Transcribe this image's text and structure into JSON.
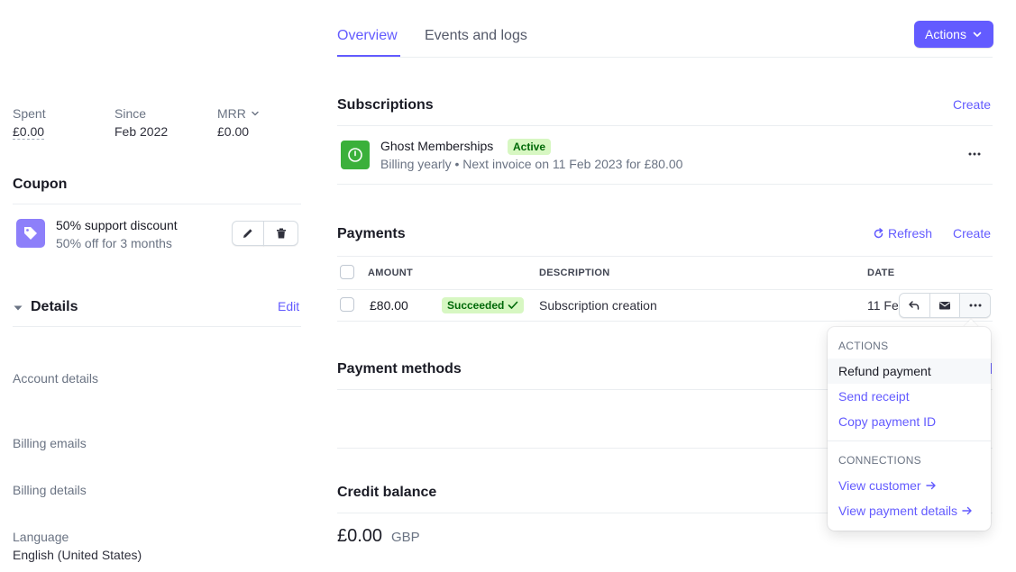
{
  "tabs": [
    {
      "label": "Overview",
      "active": true
    },
    {
      "label": "Events and logs",
      "active": false
    }
  ],
  "actions_button": {
    "label": "Actions"
  },
  "stats": [
    {
      "label": "Spent",
      "value": "£0.00"
    },
    {
      "label": "Since",
      "value": "Feb 2022"
    },
    {
      "label": "MRR",
      "value": "£0.00"
    }
  ],
  "coupon": {
    "heading": "Coupon",
    "name": "50% support discount",
    "description": "50% off for 3 months"
  },
  "details": {
    "heading": "Details",
    "edit_label": "Edit",
    "rows": [
      {
        "label": "Account details"
      },
      {
        "label": "Billing emails"
      },
      {
        "label": "Billing details"
      },
      {
        "label": "Language",
        "value": "English (United States)"
      }
    ]
  },
  "subscriptions": {
    "heading": "Subscriptions",
    "create_label": "Create",
    "item": {
      "name": "Ghost Memberships",
      "status": "Active",
      "billing": "Billing yearly",
      "next_invoice": "Next invoice on 11 Feb 2023 for £80.00"
    }
  },
  "payments": {
    "heading": "Payments",
    "refresh_label": "Refresh",
    "create_label": "Create",
    "columns": [
      "AMOUNT",
      "DESCRIPTION",
      "DATE"
    ],
    "rows": [
      {
        "amount": "£80.00",
        "status": "Succeeded",
        "description": "Subscription creation",
        "date": "11 Feb"
      }
    ]
  },
  "payment_methods": {
    "heading": "Payment methods"
  },
  "credit_balance": {
    "heading": "Credit balance",
    "amount": "£0.00",
    "currency": "GBP"
  },
  "row_menu": {
    "sections": [
      {
        "caption": "ACTIONS",
        "items": [
          "Refund payment",
          "Send receipt",
          "Copy payment ID"
        ]
      },
      {
        "caption": "CONNECTIONS",
        "items": [
          "View customer",
          "View payment details"
        ]
      }
    ]
  },
  "colors": {
    "accent": "#635bff",
    "success_bg": "#d7f7c2",
    "success_text": "#006908",
    "sub_icon": "#3bb03b"
  }
}
